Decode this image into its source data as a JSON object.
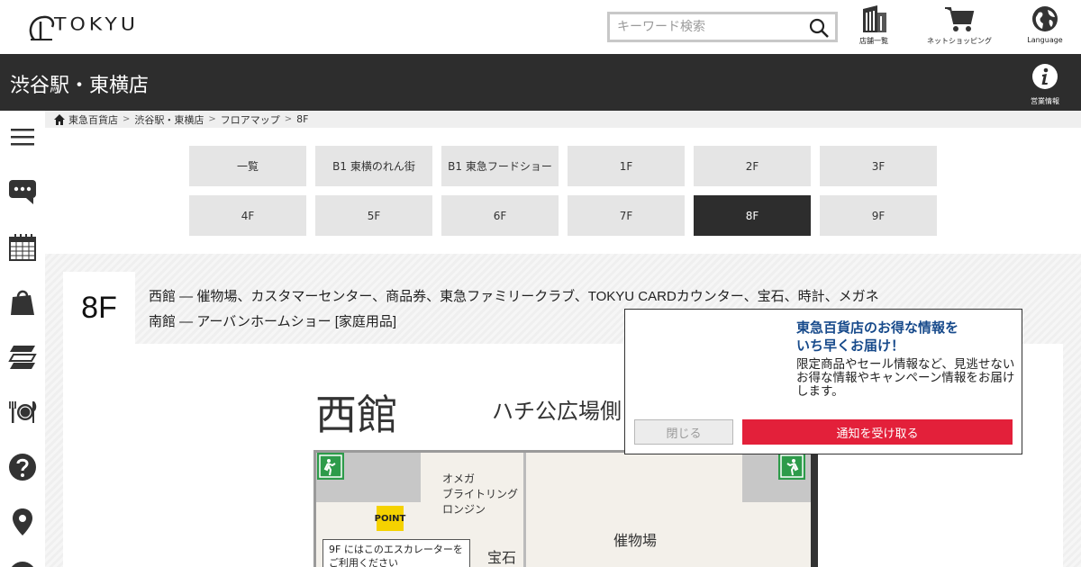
{
  "header": {
    "logo_text": "TOKYU",
    "search": {
      "placeholder": "キーワード検索"
    },
    "stores_label": "店舗一覧",
    "shopping_label": "ネットショッピング",
    "language_label": "Language"
  },
  "storebar": {
    "title": "渋谷駅・東横店",
    "hours_label": "営業情報"
  },
  "sidebar": {
    "icons": [
      "menu-icon",
      "chat-icon",
      "calendar-icon",
      "shopping-bag-icon",
      "layers-icon",
      "dining-icon",
      "help-icon",
      "location-icon"
    ]
  },
  "breadcrumb": {
    "items": [
      "東急百貨店",
      "渋谷駅・東横店",
      "フロアマップ",
      "8F"
    ]
  },
  "floors": {
    "buttons": [
      "一覧",
      "B1 東横のれん街",
      "B1 東急フードショー",
      "1F",
      "2F",
      "3F",
      "4F",
      "5F",
      "6F",
      "7F",
      "8F",
      "9F"
    ],
    "active": "8F"
  },
  "floor_info": {
    "label": "8F",
    "lines": [
      "西館 ― 催物場、カスタマーセンター、商品券、東急ファミリークラブ、TOKYU CARDカウンター、宝石、時計、メガネ",
      "南館 ― アーバンホームショー [家庭用品]"
    ]
  },
  "map": {
    "building": "西館",
    "side": "ハチ公広場側",
    "watch_brands": [
      "オメガ",
      "ブライトリング",
      "ロンジン"
    ],
    "point_badge": "POINT",
    "escalator_note": [
      "9F にはこのエスカレーターを",
      "ご利用ください"
    ],
    "jewelry": "宝石",
    "event_hall": "催物場"
  },
  "popup": {
    "title_lines": [
      "東急百貨店のお得な情報を",
      "いち早くお届け！"
    ],
    "body": "限定商品やセール情報など、見逃せないお得な情報やキャンペーン情報をお届けします。",
    "close_label": "閉じる",
    "accept_label": "通知を受け取る"
  },
  "colors": {
    "dark_bar": "#2d2d2d",
    "accent_red": "#e3203a",
    "popup_title": "#174a8b",
    "exit_green": "#2d9b4a",
    "point_yellow": "#f5d200"
  }
}
